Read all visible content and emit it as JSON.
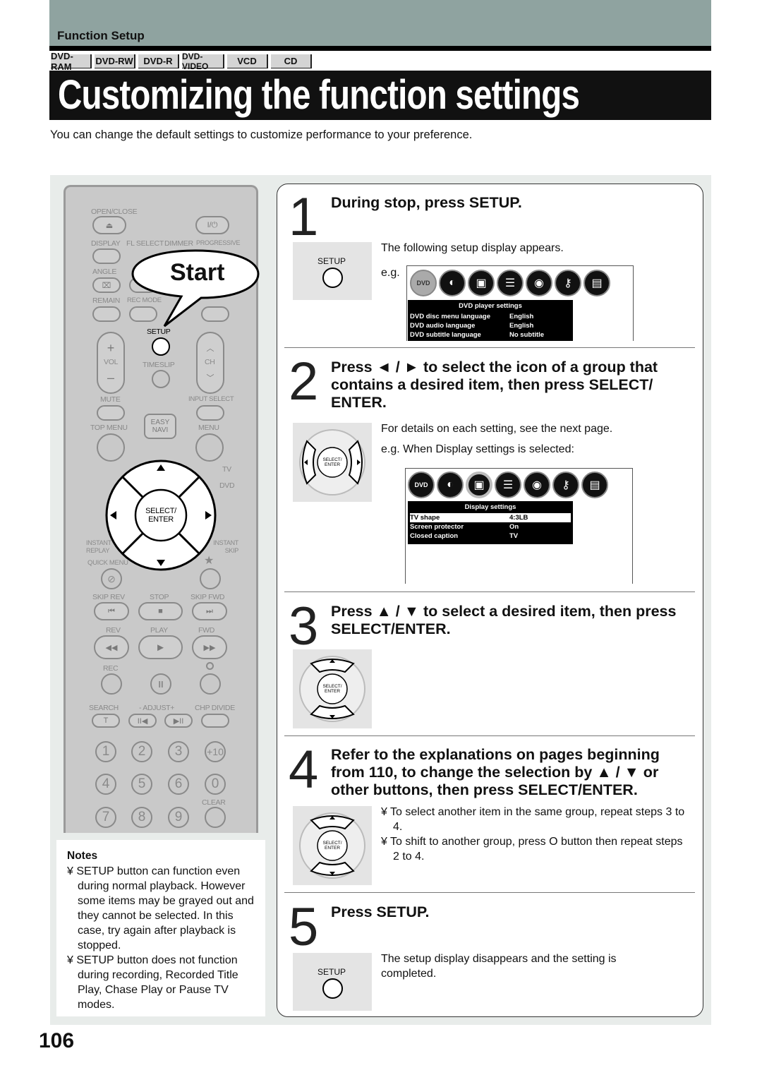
{
  "header": {
    "section": "Function Setup",
    "badges": [
      "DVD-RAM",
      "DVD-RW",
      "DVD-R",
      "DVD-VIDEO",
      "VCD",
      "CD"
    ],
    "title": "Customizing the function settings",
    "intro": "You can change the default settings to customize performance to your preference."
  },
  "remote": {
    "callout": "Start",
    "select_enter": "SELECT/ ENTER",
    "labels": [
      "OPEN/CLOSE",
      "DISPLAY",
      "FL SELECT",
      "DIMMER",
      "PROGRESSIVE",
      "ANGLE",
      "REMAIN",
      "REC MODE",
      "SETUP",
      "VOL",
      "TIMESLIP",
      "CH",
      "MUTE",
      "INPUT SELECT",
      "TOP MENU",
      "EASY NAVI",
      "MENU",
      "TV",
      "DVD",
      "INSTANT REPLAY",
      "INSTANT SKIP",
      "QUICK MENU",
      "SKIP REV",
      "STOP",
      "SKIP FWD",
      "REV",
      "PLAY",
      "FWD",
      "REC",
      "SEARCH",
      "- ADJUST+",
      "CHP DIVIDE",
      "CLEAR"
    ],
    "numbers": [
      "1",
      "2",
      "3",
      "+10",
      "4",
      "5",
      "6",
      "0",
      "7",
      "8",
      "9",
      ""
    ]
  },
  "notes": {
    "title": "Notes",
    "items": [
      "¥ SETUP button can function even during normal playback. However some items may be grayed out and they cannot be selected. In this case, try again after playback is stopped.",
      "¥ SETUP button does not function during recording, Recorded Title Play, Chase Play or Pause TV modes."
    ]
  },
  "steps": [
    {
      "num": "1",
      "heading": "During stop, press SETUP.",
      "button": "SETUP",
      "text": "The following setup display appears.",
      "eg": "e.g.",
      "screen": {
        "title": "DVD player settings",
        "rows": [
          [
            "DVD disc menu language",
            "English"
          ],
          [
            "DVD audio language",
            "English"
          ],
          [
            "DVD subtitle language",
            "No subtitle"
          ]
        ]
      }
    },
    {
      "num": "2",
      "heading": "Press ◄ / ► to select the icon of a group that contains a desired item, then press SELECT/ ENTER.",
      "text": "For details on each setting, see the next page.",
      "eg": "e.g. When  Display settings  is selected:",
      "screen": {
        "title": "Display settings",
        "rows": [
          [
            "TV shape",
            "4:3LB"
          ],
          [
            "Screen protector",
            "On"
          ],
          [
            "Closed caption",
            "TV"
          ]
        ]
      }
    },
    {
      "num": "3",
      "heading": "Press ▲ / ▼ to select a desired item, then press SELECT/ENTER."
    },
    {
      "num": "4",
      "heading": "Refer to the explanations on pages beginning from 110, to change the selection by ▲ / ▼ or other buttons, then press SELECT/ENTER.",
      "bullets": [
        "¥  To select another item in the same group, repeat steps 3 to 4.",
        "¥  To shift to another group, press O button then repeat steps 2 to 4."
      ]
    },
    {
      "num": "5",
      "heading": "Press SETUP.",
      "button": "SETUP",
      "text": "The setup display disappears and the setting is completed."
    }
  ],
  "setup_icons": [
    "dvd-video-icon",
    "picture-icon",
    "display-icon",
    "audio-icon",
    "disc-icon",
    "lock-key-icon",
    "device-icon"
  ],
  "page_number": "106"
}
